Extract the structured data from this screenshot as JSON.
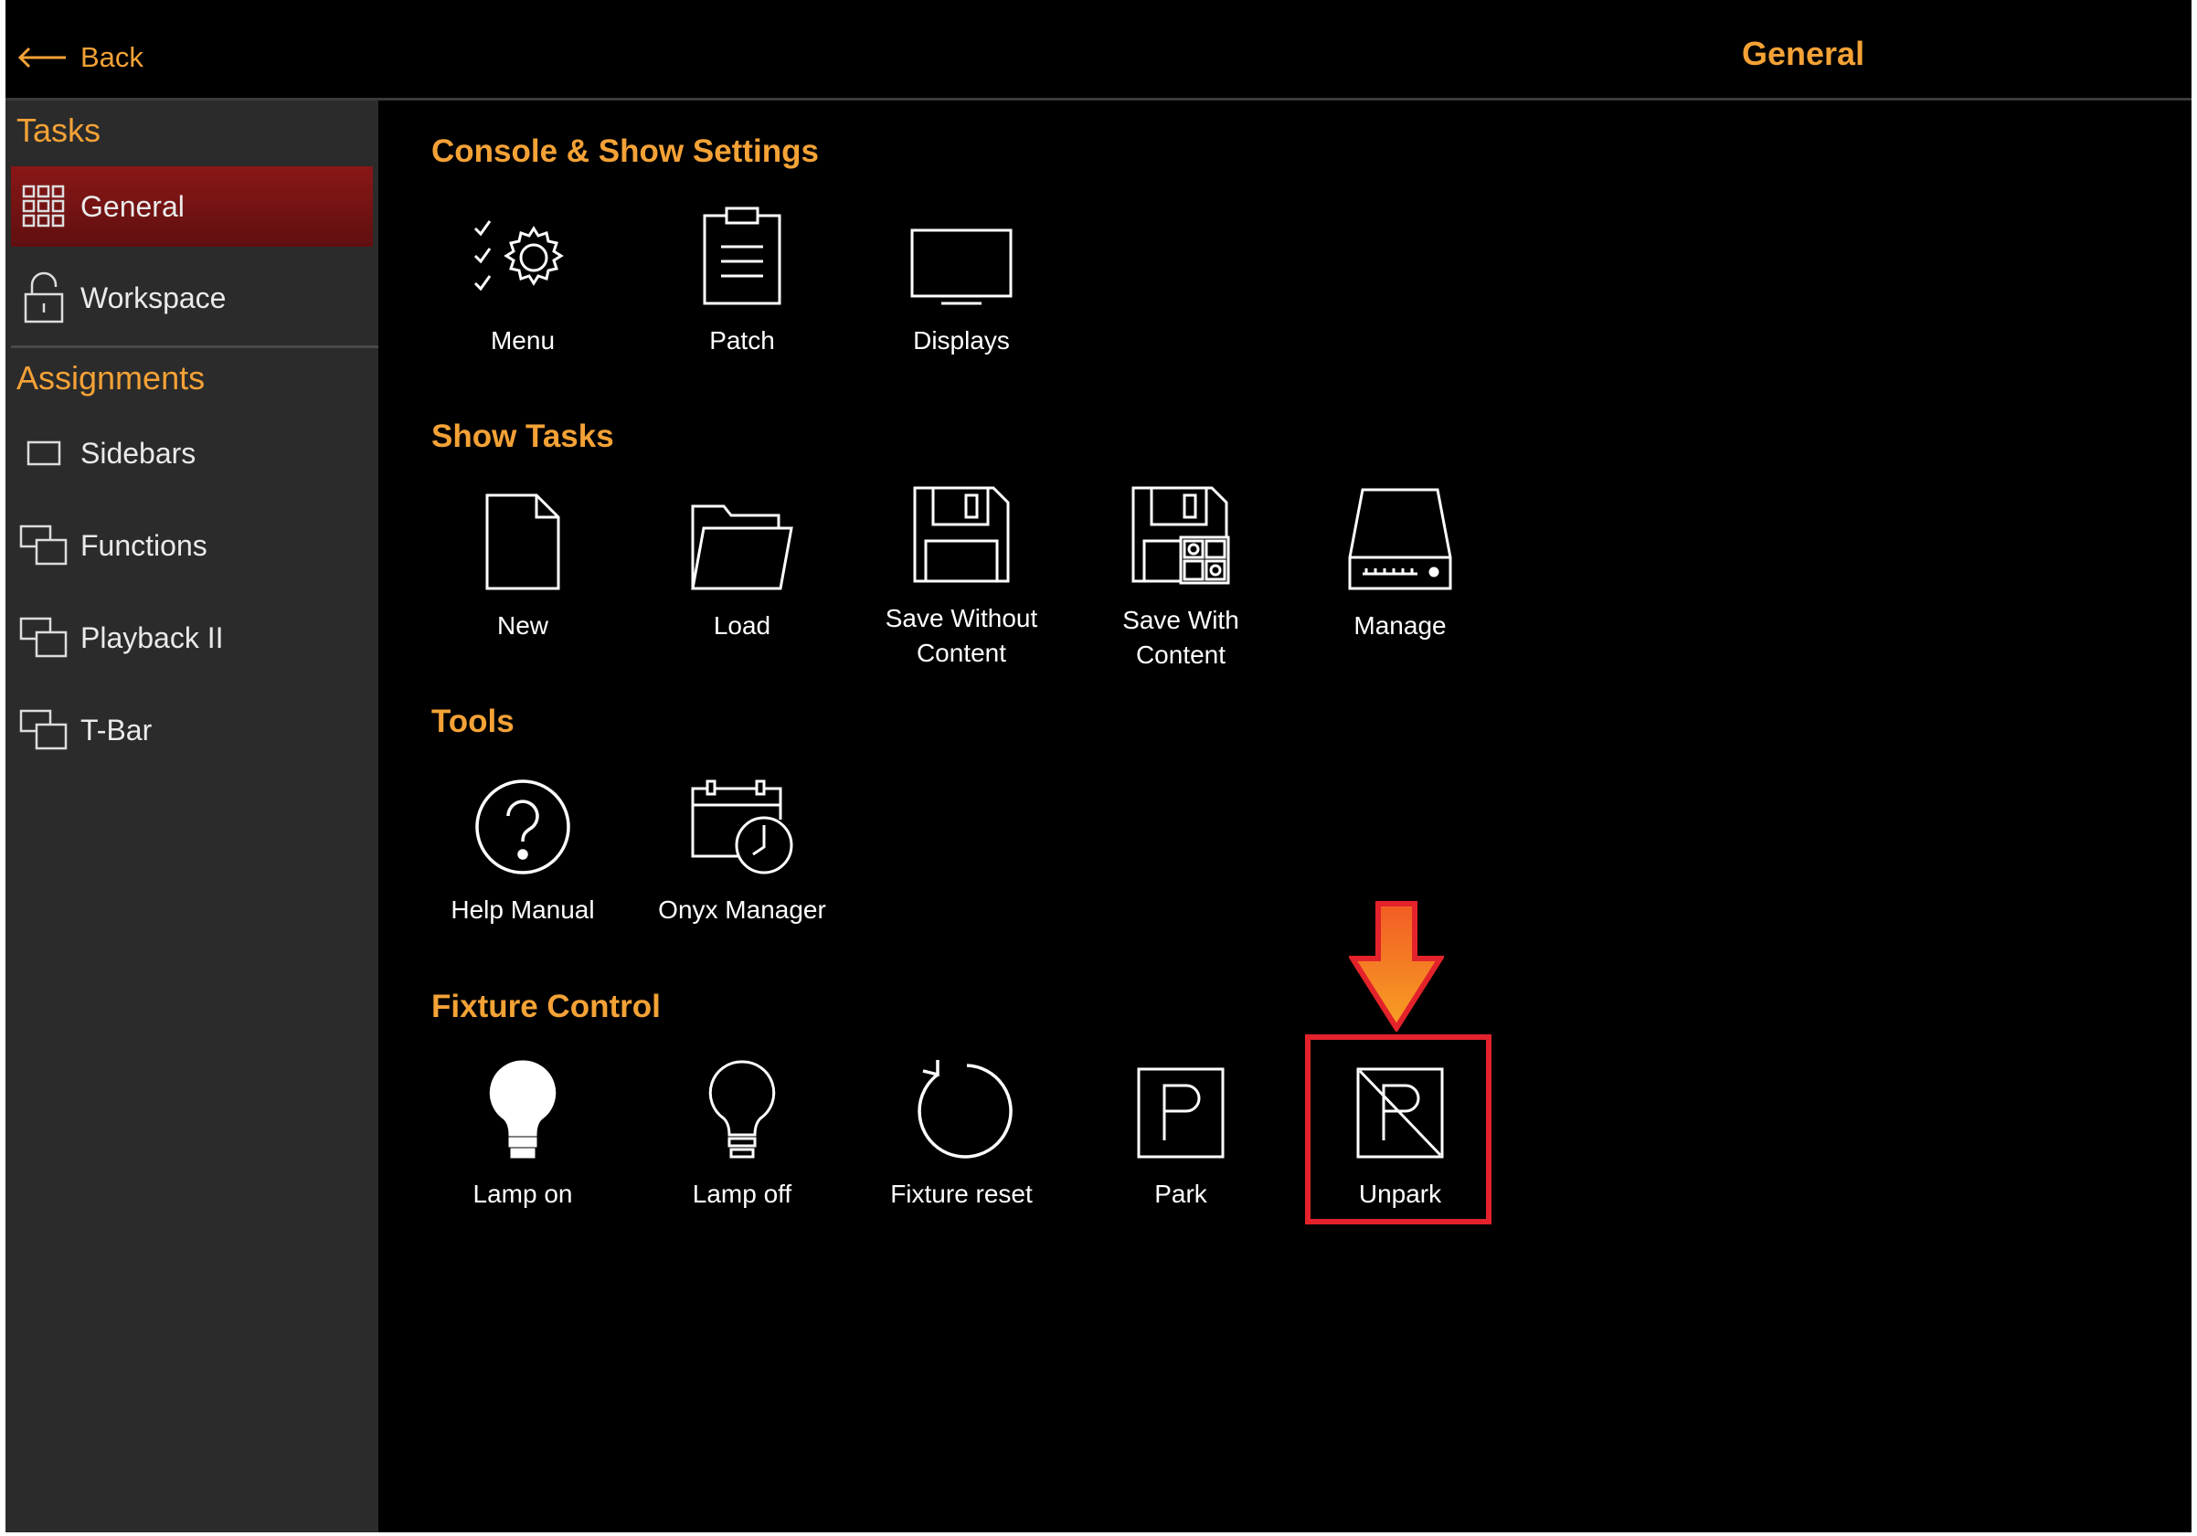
{
  "header": {
    "back_label": "Back",
    "title": "General"
  },
  "sidebar": {
    "tasks_title": "Tasks",
    "tasks": [
      {
        "label": "General",
        "icon": "grid-icon",
        "active": true
      },
      {
        "label": "Workspace",
        "icon": "unlock-icon",
        "active": false
      }
    ],
    "assignments_title": "Assignments",
    "assignments": [
      {
        "label": "Sidebars",
        "icon": "rectangle-icon"
      },
      {
        "label": "Functions",
        "icon": "windows-icon"
      },
      {
        "label": "Playback II",
        "icon": "windows-icon"
      },
      {
        "label": "T-Bar",
        "icon": "windows-icon"
      }
    ]
  },
  "groups": [
    {
      "title": "Console & Show Settings",
      "items": [
        {
          "label": "Menu",
          "icon": "gear-checklist-icon"
        },
        {
          "label": "Patch",
          "icon": "clipboard-icon"
        },
        {
          "label": "Displays",
          "icon": "monitor-icon"
        }
      ]
    },
    {
      "title": "Show Tasks",
      "items": [
        {
          "label": "New",
          "icon": "new-file-icon"
        },
        {
          "label": "Load",
          "icon": "folder-icon"
        },
        {
          "label": "Save Without\nContent",
          "icon": "floppy-disk-icon"
        },
        {
          "label": "Save With\nContent",
          "icon": "floppy-disk-content-icon"
        },
        {
          "label": "Manage",
          "icon": "drive-icon"
        }
      ]
    },
    {
      "title": "Tools",
      "items": [
        {
          "label": "Help Manual",
          "icon": "help-circle-icon"
        },
        {
          "label": "Onyx Manager",
          "icon": "calendar-clock-icon"
        }
      ]
    },
    {
      "title": "Fixture Control",
      "items": [
        {
          "label": "Lamp on",
          "icon": "bulb-filled-icon"
        },
        {
          "label": "Lamp off",
          "icon": "bulb-outline-icon"
        },
        {
          "label": "Fixture reset",
          "icon": "reset-icon"
        },
        {
          "label": "Park",
          "icon": "park-icon"
        },
        {
          "label": "Unpark",
          "icon": "unpark-icon"
        }
      ]
    }
  ],
  "annotation": {
    "highlighted_item": "Unpark",
    "box_color": "#e4222b",
    "arrow_color": "#f47b20"
  },
  "colors": {
    "accent": "#f4a236",
    "sidebar_bg": "#2b2b2b",
    "active_bg": "#7a1515",
    "background": "#000000"
  }
}
